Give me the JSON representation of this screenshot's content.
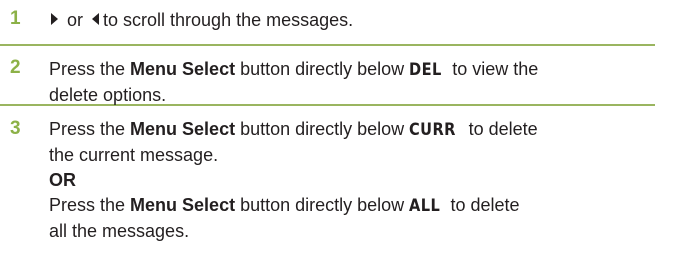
{
  "steps": [
    {
      "number": "1",
      "parts": {
        "or": " or ",
        "rest": "to scroll through the messages."
      }
    },
    {
      "number": "2",
      "line1_prefix": "Press the ",
      "menu_select": "Menu Select",
      "line1_mid": " button directly below ",
      "key": "DEL",
      "line1_suffix": " to view the",
      "line2": "delete options."
    },
    {
      "number": "3",
      "a_prefix": "Press the ",
      "a_menu_select": "Menu Select",
      "a_mid": " button directly below ",
      "a_key": "CURR",
      "a_suffix": " to delete",
      "a_line2": "the current message.",
      "or_label": "OR",
      "b_prefix": "Press the ",
      "b_menu_select": "Menu Select",
      "b_mid": " button directly below ",
      "b_key": "ALL",
      "b_suffix": " to delete",
      "b_line2": "all the messages."
    }
  ],
  "colors": {
    "step_number": "#8cb147",
    "divider": "#9ab560",
    "text": "#231f20"
  },
  "icons": {
    "right_arrow": "right-arrow-icon",
    "left_arrow": "left-arrow-icon"
  }
}
